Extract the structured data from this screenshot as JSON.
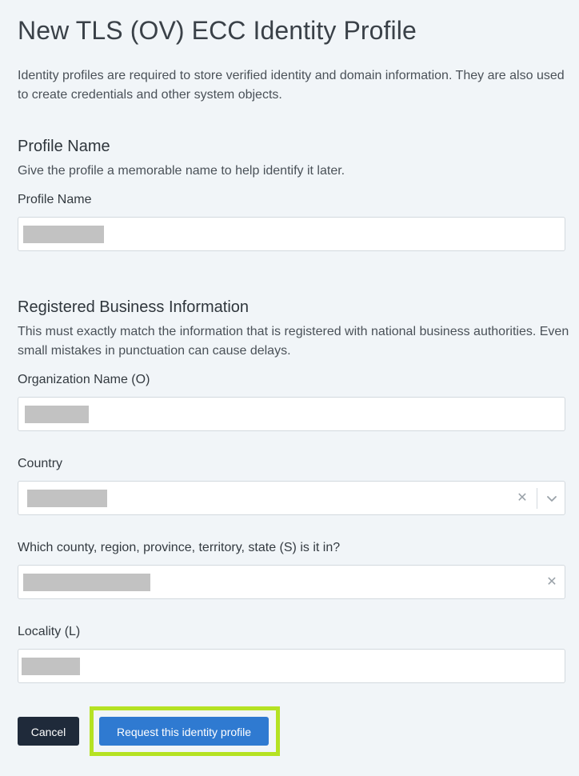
{
  "page": {
    "title": "New TLS (OV) ECC Identity Profile",
    "intro": "Identity profiles are required to store verified identity and domain information. They are also used to create credentials and other system objects."
  },
  "profile_section": {
    "heading": "Profile Name",
    "description": "Give the profile a memorable name to help identify it later.",
    "field": {
      "label": "Profile Name",
      "value": ""
    }
  },
  "business_section": {
    "heading": "Registered Business Information",
    "description": "This must exactly match the information that is registered with national business authorities. Even small mistakes in punctuation can cause delays.",
    "organization": {
      "label": "Organization Name (O)",
      "value": ""
    },
    "country": {
      "label": "Country",
      "value": "",
      "clear_icon": "close-icon",
      "dropdown_icon": "chevron-down-icon"
    },
    "state": {
      "label": "Which county, region, province, territory, state (S) is it in?",
      "value": "",
      "clear_icon": "close-icon"
    },
    "locality": {
      "label": "Locality (L)",
      "value": ""
    }
  },
  "actions": {
    "cancel_label": "Cancel",
    "submit_label": "Request this identity profile"
  },
  "glyphs": {
    "clear": "✕"
  },
  "colors": {
    "background": "#f1f5f8",
    "cancel_button": "#1f2a3a",
    "primary_button": "#2f7ad1",
    "highlight": "#b5e223",
    "redaction": "#c2c2c2"
  }
}
